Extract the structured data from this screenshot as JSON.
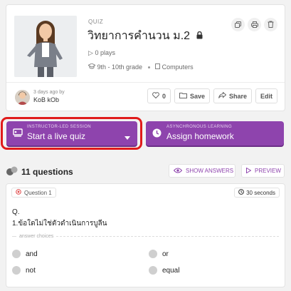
{
  "quiz": {
    "type_label": "QUIZ",
    "title": "วิทยาการคำนวน ม.2",
    "plays": "0 plays",
    "grade": "9th - 10th grade",
    "subject": "Computers",
    "ago": "3 days ago by",
    "author": "KoB kOb",
    "like_count": "0",
    "save_label": "Save",
    "share_label": "Share",
    "edit_label": "Edit"
  },
  "live_button": {
    "sub": "INSTRUCTOR-LED SESSION",
    "main": "Start a live quiz"
  },
  "homework_button": {
    "sub": "ASYNCHRONOUS LEARNING",
    "main": "Assign homework"
  },
  "questions": {
    "count_label": "11 questions",
    "show_answers": "SHOW ANSWERS",
    "preview": "PREVIEW"
  },
  "question1": {
    "label": "Question 1",
    "time": "30 seconds",
    "line1": "Q.",
    "line2": "1.ข้อใดไม่ใช่ตัวดำเนินการบูลีน",
    "choices_label": "answer choices",
    "choices": [
      "and",
      "or",
      "not",
      "equal"
    ]
  },
  "colors": {
    "accent": "#8e44ad",
    "highlight": "#e01b1b"
  }
}
